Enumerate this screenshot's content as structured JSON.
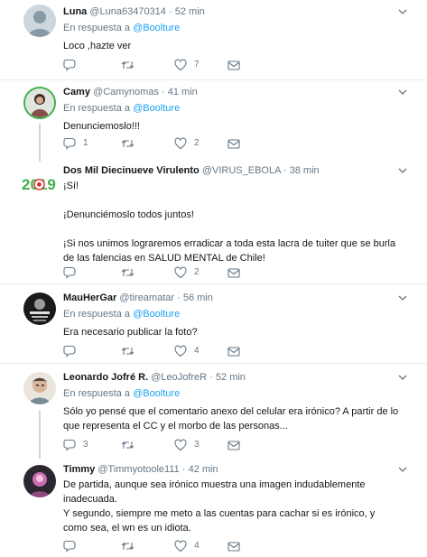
{
  "tweets": [
    {
      "name": "Luna",
      "handle": "@Luna63470314",
      "time": "52 min",
      "reply_label": "En respuesta a",
      "reply_to": "@Boolture",
      "text": [
        "Loco ,hazte ver"
      ],
      "counts": {
        "reply": "",
        "retweet": "",
        "like": "7"
      }
    },
    {
      "name": "Camy",
      "handle": "@Camynomas",
      "time": "41 min",
      "reply_label": "En respuesta a",
      "reply_to": "@Boolture",
      "text": [
        "Denunciemoslo!!!"
      ],
      "counts": {
        "reply": "1",
        "retweet": "",
        "like": "2"
      }
    },
    {
      "name": "Dos Mil Diecinueve Virulento",
      "handle": "@VIRUS_EBOLA",
      "time": "38 min",
      "avatar_text": "2019",
      "text": [
        "¡Sí!",
        "¡Denunciémoslo todos juntos!",
        "¡Si nos unimos lograremos erradicar a toda esta lacra de tuiter que se burla de las falencias en SALUD MENTAL de Chile!"
      ],
      "counts": {
        "reply": "",
        "retweet": "",
        "like": "2"
      }
    },
    {
      "name": "MauHerGar",
      "handle": "@tireamatar",
      "time": "56 min",
      "reply_label": "En respuesta a",
      "reply_to": "@Boolture",
      "text": [
        "Era necesario publicar la foto?"
      ],
      "counts": {
        "reply": "",
        "retweet": "",
        "like": "4"
      }
    },
    {
      "name": "Leonardo Jofré R.",
      "handle": "@LeoJofreR",
      "time": "52 min",
      "reply_label": "En respuesta a",
      "reply_to": "@Boolture",
      "text": [
        "Sólo yo pensé que el comentario anexo del celular era irónico? A partir de lo que representa el CC y el morbo de las personas..."
      ],
      "counts": {
        "reply": "3",
        "retweet": "",
        "like": "3"
      }
    },
    {
      "name": "Timmy",
      "handle": "@Timmyotoole111",
      "time": "42 min",
      "text": [
        "De partida, aunque sea irónico muestra una imagen indudablemente inadecuada.",
        "Y segundo, siempre me meto a las cuentas para cachar si es irónico, y como sea, el wn es un idiota."
      ],
      "counts": {
        "reply": "",
        "retweet": "",
        "like": "4"
      }
    }
  ],
  "separator": "·",
  "colors": {
    "accent": "#1da1f2",
    "secondary_text": "#657786",
    "divider": "#e6ecf0",
    "thread_line": "#ccd6dd",
    "logo_green": "#3fae49"
  },
  "icons": [
    "reply-icon",
    "retweet-icon",
    "like-icon",
    "direct-message-icon",
    "chevron-down-icon"
  ]
}
